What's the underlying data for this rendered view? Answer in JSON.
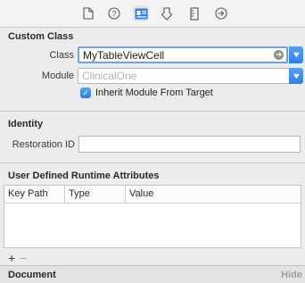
{
  "toolbar": {
    "icons": [
      "file-inspector-icon",
      "quick-help-icon",
      "identity-inspector-icon",
      "attributes-inspector-icon",
      "size-inspector-icon",
      "connections-inspector-icon"
    ],
    "selected": "identity-inspector-icon"
  },
  "custom_class": {
    "title": "Custom Class",
    "class_label": "Class",
    "class_value": "MyTableViewCell",
    "module_label": "Module",
    "module_placeholder": "ClinicalOne",
    "inherit_label": "Inherit Module From Target",
    "inherit_checked": true
  },
  "identity": {
    "title": "Identity",
    "restoration_label": "Restoration ID",
    "restoration_value": ""
  },
  "runtime_attributes": {
    "title": "User Defined Runtime Attributes",
    "columns": [
      "Key Path",
      "Type",
      "Value"
    ],
    "add_symbol": "+",
    "remove_symbol": "−"
  },
  "document": {
    "title": "Document",
    "hide_label": "Hide"
  }
}
